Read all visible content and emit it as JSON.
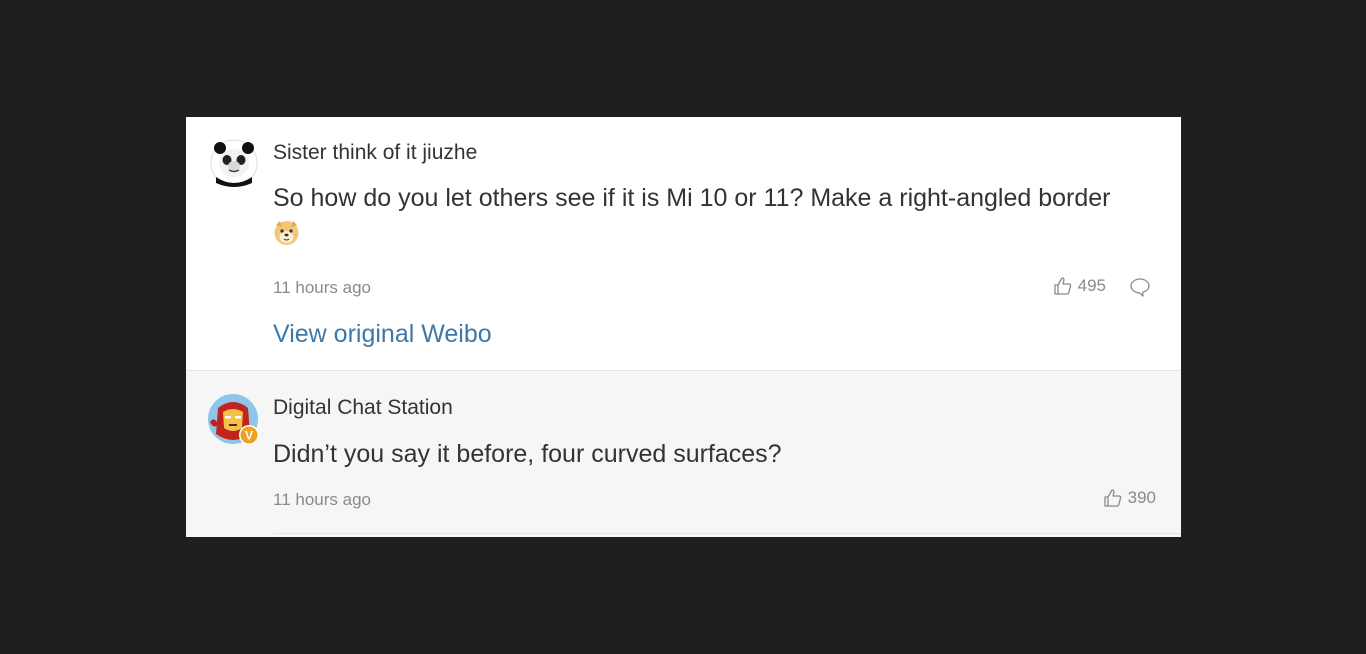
{
  "comments": [
    {
      "username": "Sister think of it jiuzhe",
      "text": "So how do you let others see if it is Mi 10 or 11? Make a right-angled border",
      "emoji": "doge-emoji",
      "time": "11 hours ago",
      "likes": "495",
      "view_original": "View original Weibo"
    },
    {
      "username": "Digital Chat Station",
      "text": "Didn’t you say it before, four curved surfaces?",
      "time": "11 hours ago",
      "likes": "390",
      "verified_badge": "V"
    }
  ],
  "colors": {
    "background": "#1f1f1f",
    "link": "#3e78a8",
    "muted": "#8a8a8a",
    "text": "#333333",
    "verified": "#f0a020"
  }
}
